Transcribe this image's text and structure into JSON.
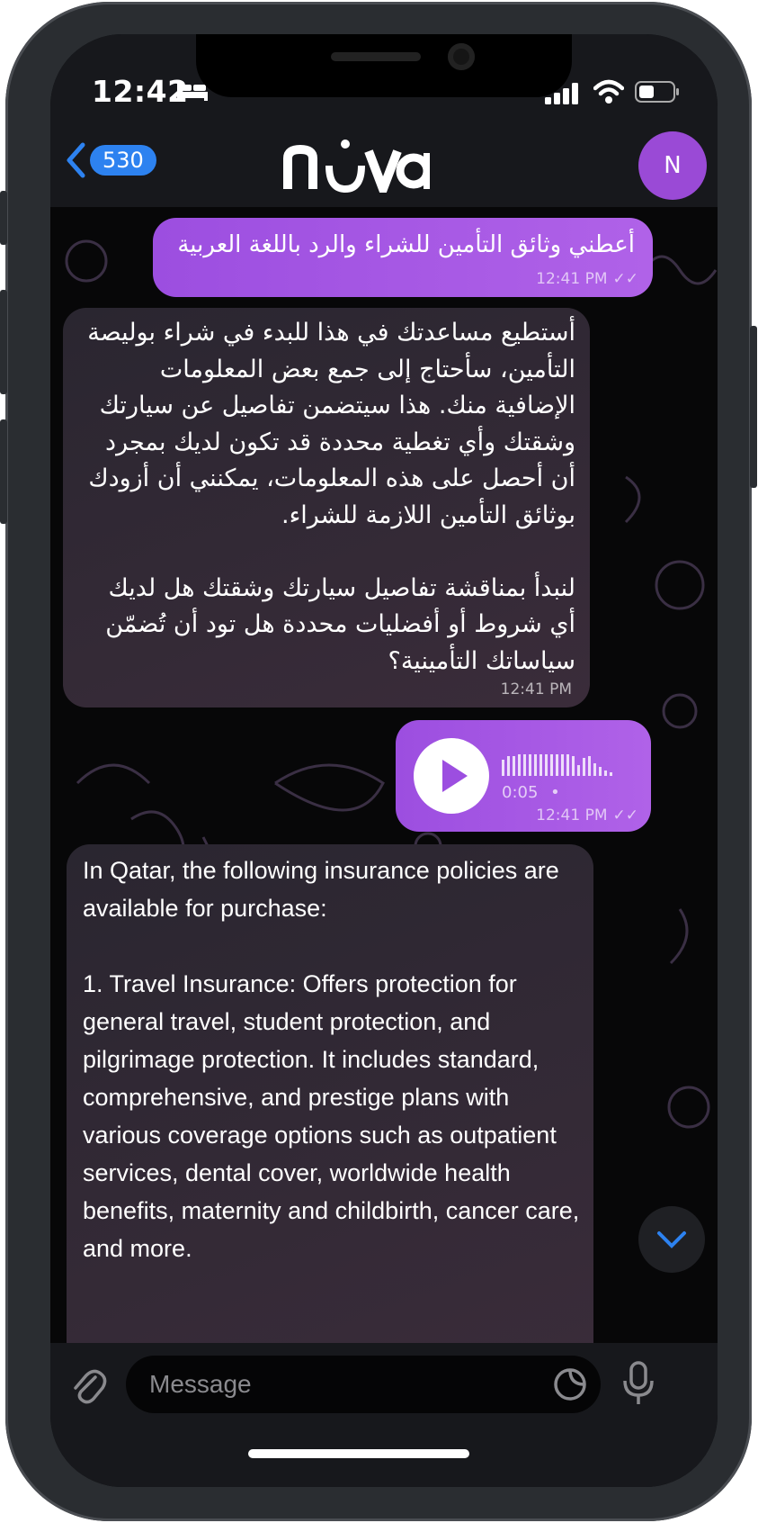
{
  "status": {
    "time": "12:42"
  },
  "header": {
    "back_count": "530",
    "logo": "nova",
    "avatar_initial": "N"
  },
  "messages": [
    {
      "direction": "out",
      "text": "أعطني وثائق التأمين للشراء والرد باللغة العربية",
      "time": "12:41 PM",
      "read": true
    },
    {
      "direction": "in",
      "text": "أستطيع مساعدتك في هذا للبدء في شراء بوليصة التأمين، سأحتاج إلى جمع بعض المعلومات الإضافية منك. هذا سيتضمن تفاصيل عن سيارتك وشقتك وأي تغطية محددة قد تكون لديك بمجرد أن أحصل على هذه المعلومات، يمكنني أن أزودك بوثائق التأمين اللازمة للشراء.\n\nلنبدأ بمناقشة تفاصيل سيارتك وشقتك هل لديك أي شروط أو أفضليات محددة هل تود أن تُضمّن سياساتك التأمينية؟",
      "time": "12:41 PM"
    },
    {
      "direction": "out",
      "type": "voice",
      "duration": "0:05",
      "time": "12:41 PM",
      "read": true
    },
    {
      "direction": "in",
      "text": "In Qatar, the following insurance policies are available for purchase:\n\n1. Travel Insurance: Offers protection for general travel, student protection, and pilgrimage protection. It includes standard, comprehensive, and prestige plans with various coverage options such as outpatient services, dental cover, worldwide health benefits, maternity and childbirth, cancer care, and more."
    }
  ],
  "composer": {
    "placeholder": "Message"
  },
  "colors": {
    "outgoing_bubble": "#a658e4",
    "incoming_bubble": "#2e2832",
    "accent_blue": "#2d82f0",
    "avatar": "#9a4ad6"
  },
  "icons": [
    "back-chevron-icon",
    "bed-icon",
    "signal-icon",
    "wifi-icon",
    "battery-icon",
    "play-icon",
    "double-check-icon",
    "chevron-down-icon",
    "paperclip-icon",
    "sticker-icon",
    "mic-icon"
  ]
}
